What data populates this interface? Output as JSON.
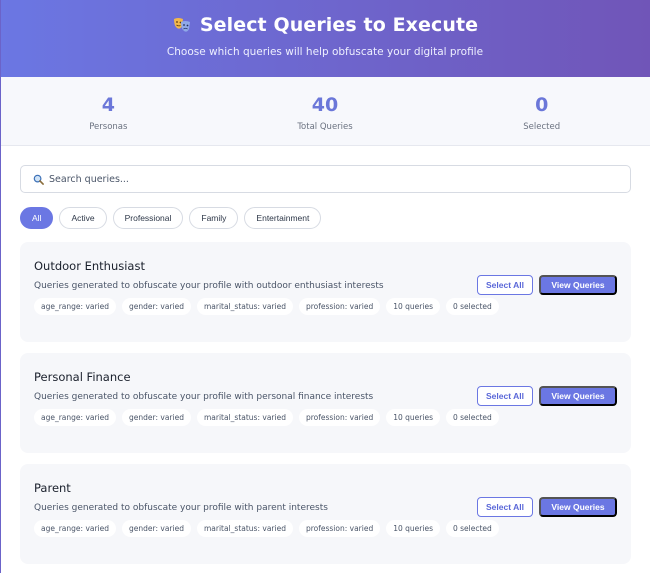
{
  "header": {
    "title": "Select Queries to Execute",
    "subtitle": "Choose which queries will help obfuscate your digital profile",
    "icon": "theater-masks-icon"
  },
  "stats": [
    {
      "value": "4",
      "label": "Personas"
    },
    {
      "value": "40",
      "label": "Total Queries"
    },
    {
      "value": "0",
      "label": "Selected"
    }
  ],
  "search": {
    "placeholder": "Search queries...",
    "icon": "magnifier-icon"
  },
  "filters": [
    "All",
    "Active",
    "Professional",
    "Family",
    "Entertainment"
  ],
  "active_filter": "All",
  "personas": [
    {
      "name": "Outdoor Enthusiast",
      "description": "Queries generated to obfuscate your profile with outdoor enthusiast interests",
      "tags": [
        "age_range: varied",
        "gender: varied",
        "marital_status: varied",
        "profession: varied",
        "10 queries",
        "0 selected"
      ],
      "select_all_label": "Select All",
      "view_label": "View Queries"
    },
    {
      "name": "Personal Finance",
      "description": "Queries generated to obfuscate your profile with personal finance interests",
      "tags": [
        "age_range: varied",
        "gender: varied",
        "marital_status: varied",
        "profession: varied",
        "10 queries",
        "0 selected"
      ],
      "select_all_label": "Select All",
      "view_label": "View Queries"
    },
    {
      "name": "Parent",
      "description": "Queries generated to obfuscate your profile with parent interests",
      "tags": [
        "age_range: varied",
        "gender: varied",
        "marital_status: varied",
        "profession: varied",
        "10 queries",
        "0 selected"
      ],
      "select_all_label": "Select All",
      "view_label": "View Queries"
    }
  ],
  "colors": {
    "accent": "#6b77e3",
    "header_start": "#6b77e3",
    "header_end": "#7055b8",
    "stat_value": "#6b77d9",
    "card_bg": "#f6f7fa"
  }
}
